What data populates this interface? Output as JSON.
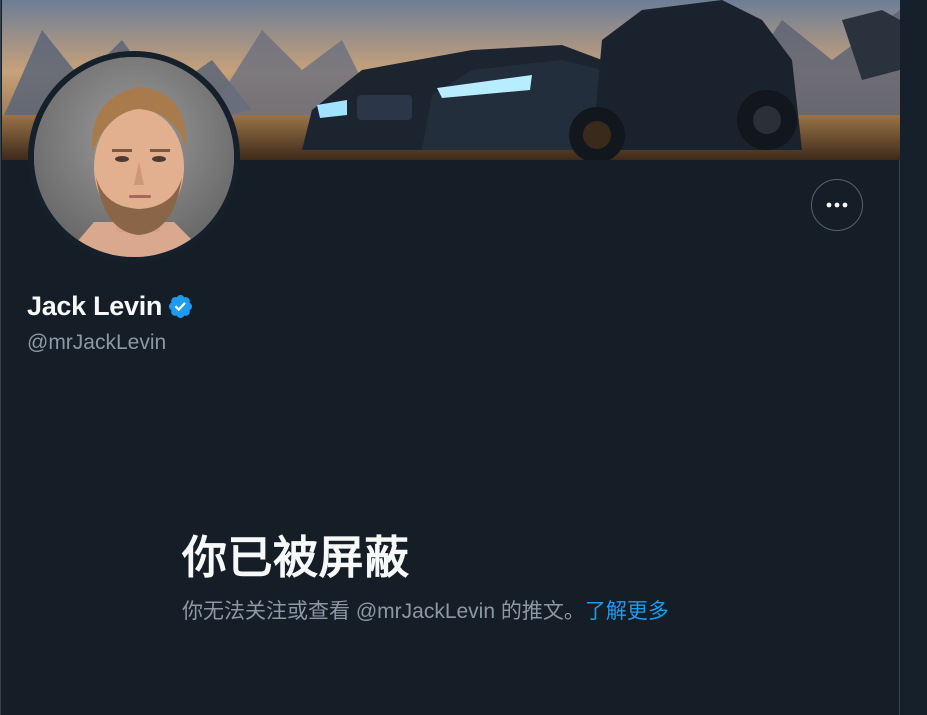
{
  "profile": {
    "display_name": "Jack Levin",
    "handle": "@mrJackLevin",
    "verified": true
  },
  "blocked_notice": {
    "title": "你已被屏蔽",
    "description": "你无法关注或查看 @mrJackLevin 的推文。",
    "learn_more": "了解更多"
  },
  "icons": {
    "more": "more-horizontal-icon",
    "verified": "verified-badge-icon"
  },
  "colors": {
    "background": "#15202b",
    "text_primary": "#f7f9f9",
    "text_secondary": "#8b98a5",
    "accent": "#1d9bf0",
    "border": "#536471"
  }
}
